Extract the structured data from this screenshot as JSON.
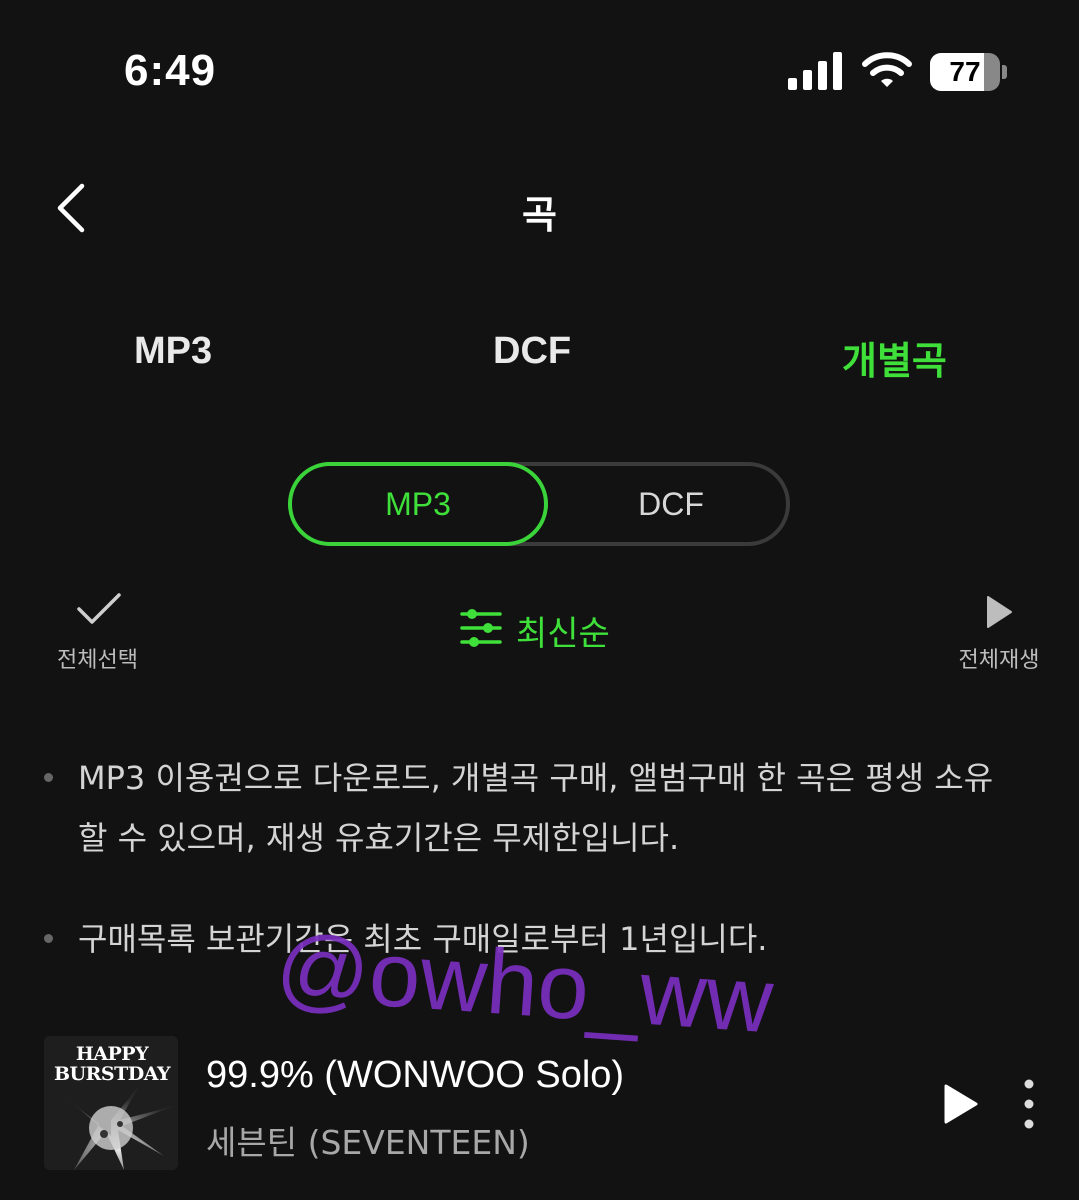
{
  "status_bar": {
    "time": "6:49",
    "battery": "77",
    "battery_level": 0.77
  },
  "header": {
    "title": "곡",
    "back_icon": "chevron-left-icon"
  },
  "tabs": [
    {
      "label": "MP3",
      "selected": false
    },
    {
      "label": "DCF",
      "selected": false
    },
    {
      "label": "개별곡",
      "selected": true
    }
  ],
  "segment": {
    "options": [
      "MP3",
      "DCF"
    ],
    "selected": "MP3"
  },
  "toolbar": {
    "select_all_label": "전체선택",
    "sort_label": "최신순",
    "play_all_label": "전체재생"
  },
  "notices": [
    "MP3 이용권으로 다운로드, 개별곡 구매, 앨범구매 한 곡은 평생 소유할 수 있으며, 재생 유효기간은 무제한입니다.",
    "구매목록 보관기간은 최초 구매일로부터 1년입니다."
  ],
  "watermark": "@owho_ww",
  "track": {
    "album_art_text_1": "HAPPY",
    "album_art_text_2": "BURSTDAY",
    "title": "99.9% (WONWOO Solo)",
    "artist": "세븐틴 (SEVENTEEN)"
  },
  "colors": {
    "background": "#121212",
    "accent": "#3fe03a",
    "watermark": "#7b2fbf"
  }
}
